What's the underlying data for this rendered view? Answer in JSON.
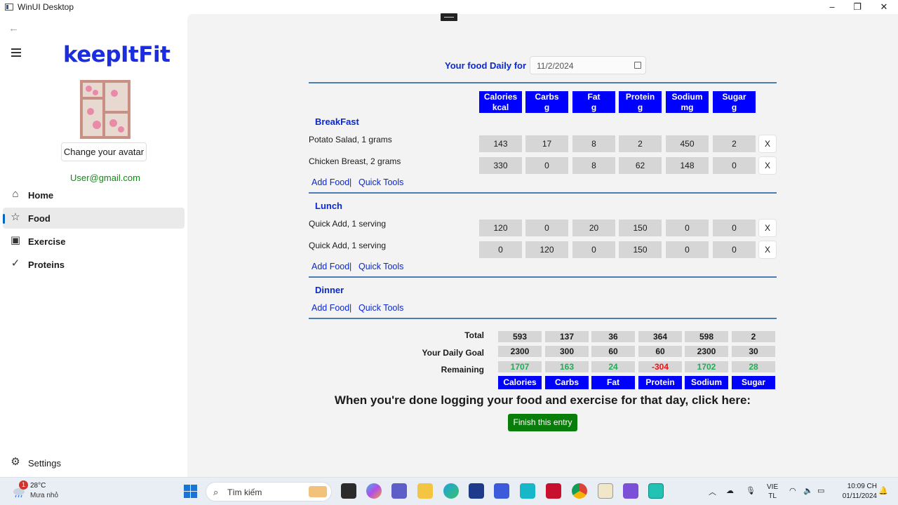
{
  "window": {
    "title": "WinUI Desktop"
  },
  "sidebar": {
    "logo": "keepItFit",
    "change_avatar_label": "Change your avatar",
    "email": "User@gmail.com",
    "nav": [
      {
        "label": "Home",
        "icon": "home-icon"
      },
      {
        "label": "Food",
        "icon": "star-icon",
        "selected": true
      },
      {
        "label": "Exercise",
        "icon": "exercise-icon"
      },
      {
        "label": "Proteins",
        "icon": "checkmark-icon"
      }
    ],
    "settings_label": "Settings"
  },
  "diary": {
    "date_label": "Your food Daily for",
    "date_value": "11/2/2024",
    "columns": [
      {
        "name": "Calories",
        "unit": "kcal"
      },
      {
        "name": "Carbs",
        "unit": "g"
      },
      {
        "name": "Fat",
        "unit": "g"
      },
      {
        "name": "Protein",
        "unit": "g"
      },
      {
        "name": "Sodium",
        "unit": "mg"
      },
      {
        "name": "Sugar",
        "unit": "g"
      }
    ],
    "remove_label": "X",
    "add_food_label": "Add Food",
    "separator": "|",
    "quick_tools_label": "Quick Tools",
    "meals": [
      {
        "name": "BreakFast",
        "items": [
          {
            "name": "Potato Salad, 1 grams",
            "values": [
              "143",
              "17",
              "8",
              "2",
              "450",
              "2"
            ]
          },
          {
            "name": "Chicken Breast, 2 grams",
            "values": [
              "330",
              "0",
              "8",
              "62",
              "148",
              "0"
            ]
          }
        ]
      },
      {
        "name": "Lunch",
        "items": [
          {
            "name": "Quick Add, 1 serving",
            "values": [
              "120",
              "0",
              "20",
              "150",
              "0",
              "0"
            ]
          },
          {
            "name": "Quick Add, 1 serving",
            "values": [
              "0",
              "120",
              "0",
              "150",
              "0",
              "0"
            ]
          }
        ]
      },
      {
        "name": "Dinner",
        "items": []
      }
    ]
  },
  "summary": {
    "total_label": "Total",
    "goal_label": "Your Daily Goal",
    "remaining_label": "Remaining",
    "total": [
      "593",
      "137",
      "36",
      "364",
      "598",
      "2"
    ],
    "goal": [
      "2300",
      "300",
      "60",
      "60",
      "2300",
      "30"
    ],
    "remaining": [
      "1707",
      "163",
      "24",
      "-304",
      "1702",
      "28"
    ],
    "footer": [
      "Calories",
      "Carbs",
      "Fat",
      "Protein",
      "Sodium",
      "Sugar"
    ],
    "positive_color": "#22aa55",
    "negative_color": "#ee1111"
  },
  "cta": {
    "text": "When you're done logging your food and exercise for that day, click here:",
    "button_label": "Finish this entry"
  },
  "taskbar": {
    "weather_temp": "28°C",
    "weather_desc": "Mưa nhỏ",
    "weather_badge": "1",
    "search_placeholder": "Tìm kiếm",
    "lang_line1": "VIE",
    "lang_line2": "TL",
    "time": "10:09 CH",
    "date": "01/11/2024"
  },
  "colors": {
    "brand": "#1a2de0",
    "header_blue": "#0000ff",
    "finish_green": "#0a7e0a"
  }
}
